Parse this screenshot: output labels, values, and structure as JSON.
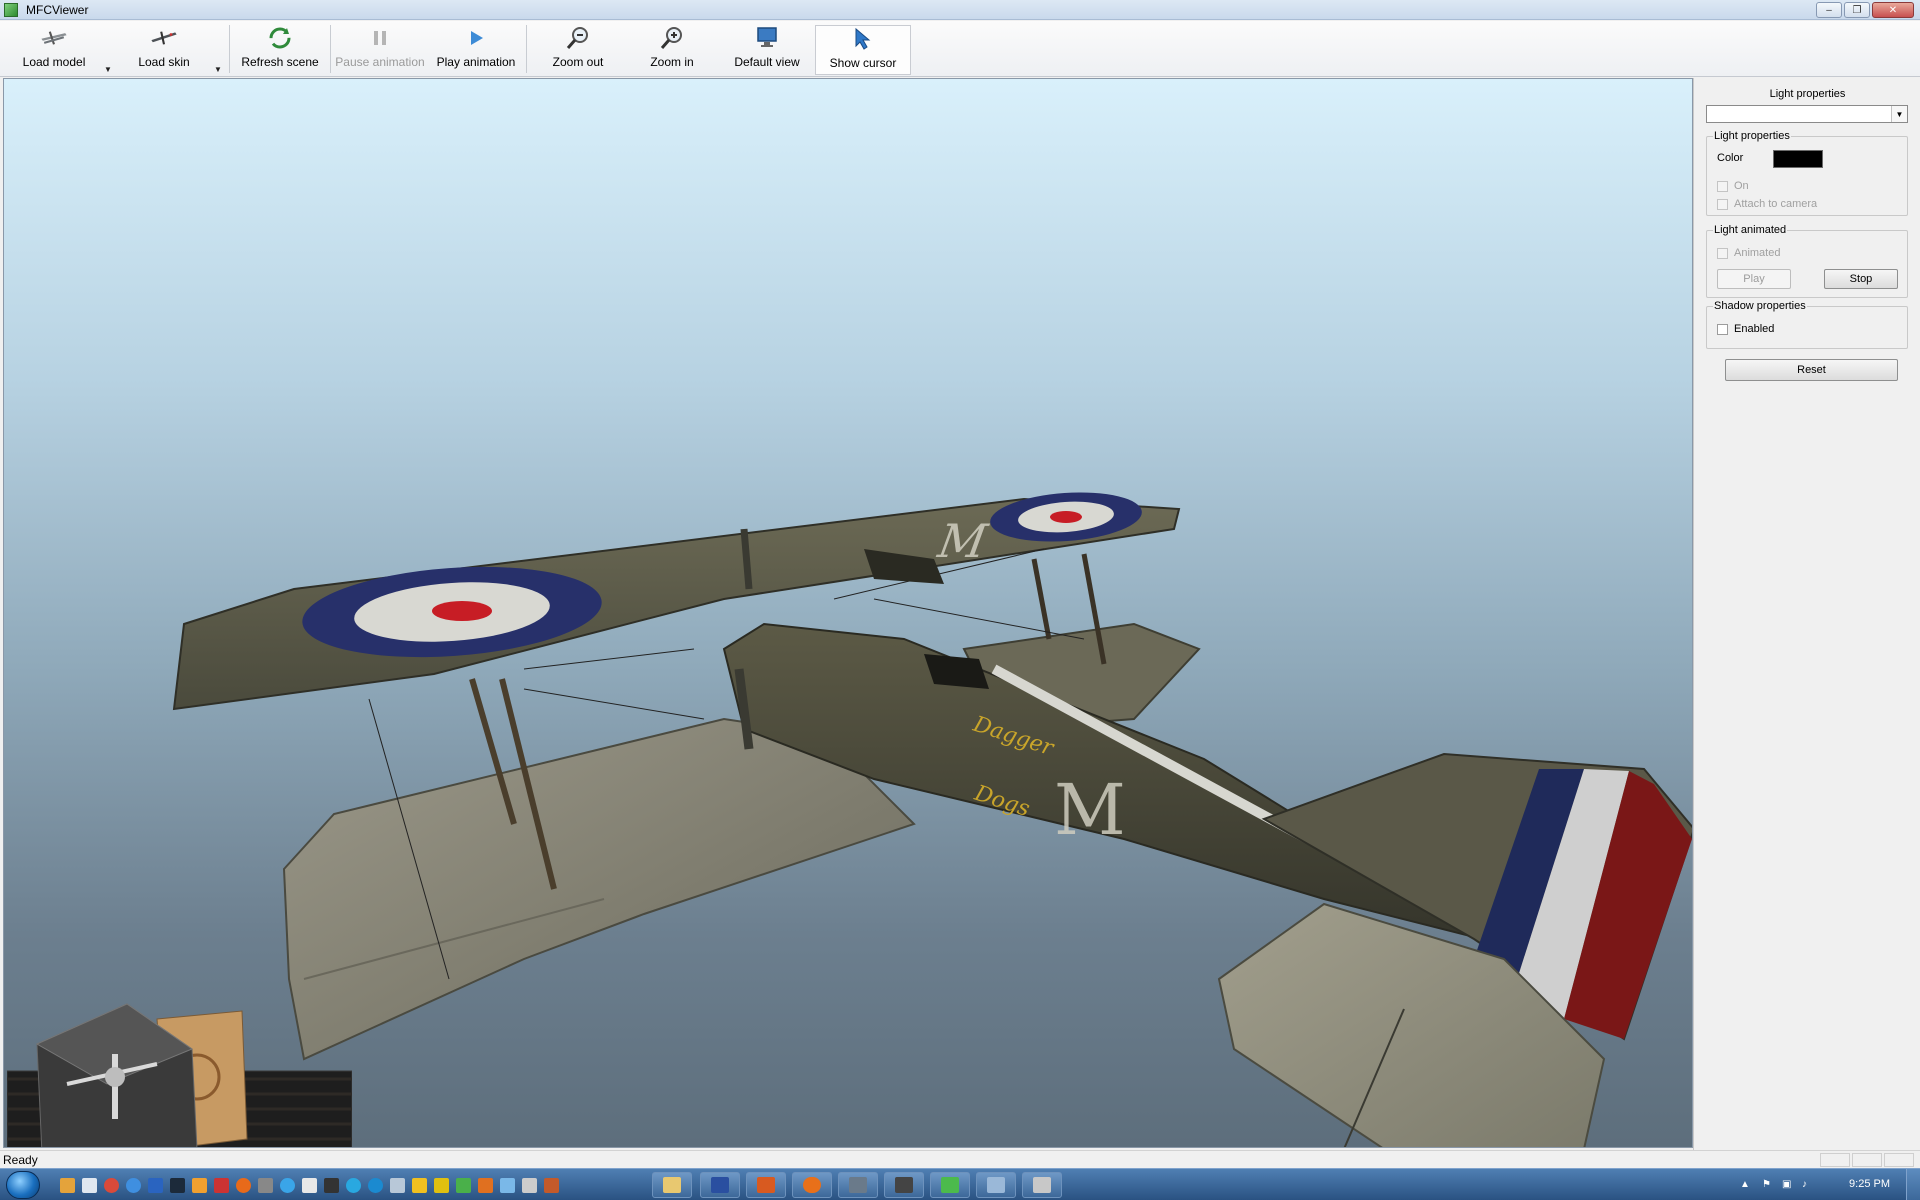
{
  "window": {
    "title": "MFCViewer"
  },
  "window_controls": {
    "minimize": "–",
    "restore": "❐",
    "close": "✕"
  },
  "toolbar": {
    "load_model": "Load model",
    "load_skin": "Load skin",
    "refresh_scene": "Refresh scene",
    "pause_animation": "Pause animation",
    "play_animation": "Play animation",
    "zoom_out": "Zoom out",
    "zoom_in": "Zoom in",
    "default_view": "Default view",
    "show_cursor": "Show cursor",
    "dropdown_glyph": "▼"
  },
  "scene": {
    "fuselage_letter": "M",
    "nose_art_line1": "Dagger",
    "nose_art_line2": "Dogs"
  },
  "panel": {
    "title": "Light properties",
    "combo_value": "",
    "combo_arrow": "▼",
    "light_group": {
      "label": "Light properties",
      "color_label": "Color",
      "color_value": "#000000",
      "on_label": "On",
      "attach_label": "Attach to camera"
    },
    "animated_group": {
      "label": "Light animated",
      "animated_label": "Animated",
      "play_label": "Play",
      "stop_label": "Stop"
    },
    "shadow_group": {
      "label": "Shadow properties",
      "enabled_label": "Enabled"
    },
    "reset_label": "Reset"
  },
  "status": {
    "text": "Ready"
  },
  "taskbar": {
    "clock": "9:25 PM"
  }
}
